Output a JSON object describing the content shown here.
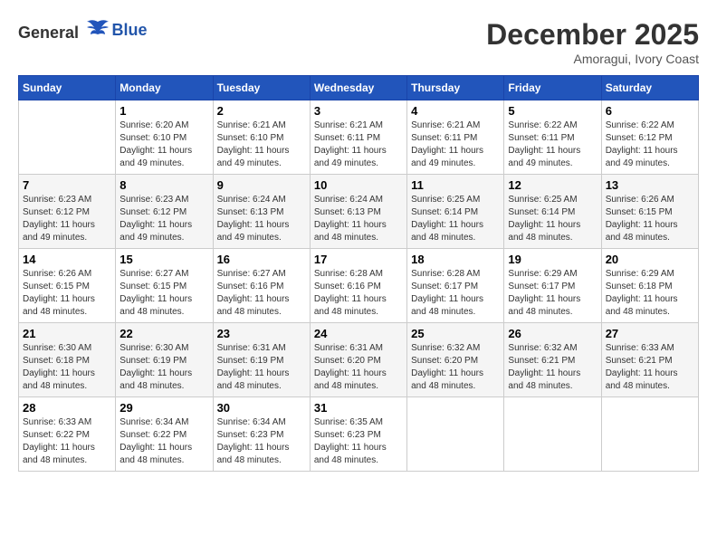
{
  "header": {
    "logo_general": "General",
    "logo_blue": "Blue",
    "month": "December 2025",
    "location": "Amoragui, Ivory Coast"
  },
  "weekdays": [
    "Sunday",
    "Monday",
    "Tuesday",
    "Wednesday",
    "Thursday",
    "Friday",
    "Saturday"
  ],
  "weeks": [
    [
      {
        "day": "",
        "sunrise": "",
        "sunset": "",
        "daylight": ""
      },
      {
        "day": "1",
        "sunrise": "Sunrise: 6:20 AM",
        "sunset": "Sunset: 6:10 PM",
        "daylight": "Daylight: 11 hours and 49 minutes."
      },
      {
        "day": "2",
        "sunrise": "Sunrise: 6:21 AM",
        "sunset": "Sunset: 6:10 PM",
        "daylight": "Daylight: 11 hours and 49 minutes."
      },
      {
        "day": "3",
        "sunrise": "Sunrise: 6:21 AM",
        "sunset": "Sunset: 6:11 PM",
        "daylight": "Daylight: 11 hours and 49 minutes."
      },
      {
        "day": "4",
        "sunrise": "Sunrise: 6:21 AM",
        "sunset": "Sunset: 6:11 PM",
        "daylight": "Daylight: 11 hours and 49 minutes."
      },
      {
        "day": "5",
        "sunrise": "Sunrise: 6:22 AM",
        "sunset": "Sunset: 6:11 PM",
        "daylight": "Daylight: 11 hours and 49 minutes."
      },
      {
        "day": "6",
        "sunrise": "Sunrise: 6:22 AM",
        "sunset": "Sunset: 6:12 PM",
        "daylight": "Daylight: 11 hours and 49 minutes."
      }
    ],
    [
      {
        "day": "7",
        "sunrise": "Sunrise: 6:23 AM",
        "sunset": "Sunset: 6:12 PM",
        "daylight": "Daylight: 11 hours and 49 minutes."
      },
      {
        "day": "8",
        "sunrise": "Sunrise: 6:23 AM",
        "sunset": "Sunset: 6:12 PM",
        "daylight": "Daylight: 11 hours and 49 minutes."
      },
      {
        "day": "9",
        "sunrise": "Sunrise: 6:24 AM",
        "sunset": "Sunset: 6:13 PM",
        "daylight": "Daylight: 11 hours and 49 minutes."
      },
      {
        "day": "10",
        "sunrise": "Sunrise: 6:24 AM",
        "sunset": "Sunset: 6:13 PM",
        "daylight": "Daylight: 11 hours and 48 minutes."
      },
      {
        "day": "11",
        "sunrise": "Sunrise: 6:25 AM",
        "sunset": "Sunset: 6:14 PM",
        "daylight": "Daylight: 11 hours and 48 minutes."
      },
      {
        "day": "12",
        "sunrise": "Sunrise: 6:25 AM",
        "sunset": "Sunset: 6:14 PM",
        "daylight": "Daylight: 11 hours and 48 minutes."
      },
      {
        "day": "13",
        "sunrise": "Sunrise: 6:26 AM",
        "sunset": "Sunset: 6:15 PM",
        "daylight": "Daylight: 11 hours and 48 minutes."
      }
    ],
    [
      {
        "day": "14",
        "sunrise": "Sunrise: 6:26 AM",
        "sunset": "Sunset: 6:15 PM",
        "daylight": "Daylight: 11 hours and 48 minutes."
      },
      {
        "day": "15",
        "sunrise": "Sunrise: 6:27 AM",
        "sunset": "Sunset: 6:15 PM",
        "daylight": "Daylight: 11 hours and 48 minutes."
      },
      {
        "day": "16",
        "sunrise": "Sunrise: 6:27 AM",
        "sunset": "Sunset: 6:16 PM",
        "daylight": "Daylight: 11 hours and 48 minutes."
      },
      {
        "day": "17",
        "sunrise": "Sunrise: 6:28 AM",
        "sunset": "Sunset: 6:16 PM",
        "daylight": "Daylight: 11 hours and 48 minutes."
      },
      {
        "day": "18",
        "sunrise": "Sunrise: 6:28 AM",
        "sunset": "Sunset: 6:17 PM",
        "daylight": "Daylight: 11 hours and 48 minutes."
      },
      {
        "day": "19",
        "sunrise": "Sunrise: 6:29 AM",
        "sunset": "Sunset: 6:17 PM",
        "daylight": "Daylight: 11 hours and 48 minutes."
      },
      {
        "day": "20",
        "sunrise": "Sunrise: 6:29 AM",
        "sunset": "Sunset: 6:18 PM",
        "daylight": "Daylight: 11 hours and 48 minutes."
      }
    ],
    [
      {
        "day": "21",
        "sunrise": "Sunrise: 6:30 AM",
        "sunset": "Sunset: 6:18 PM",
        "daylight": "Daylight: 11 hours and 48 minutes."
      },
      {
        "day": "22",
        "sunrise": "Sunrise: 6:30 AM",
        "sunset": "Sunset: 6:19 PM",
        "daylight": "Daylight: 11 hours and 48 minutes."
      },
      {
        "day": "23",
        "sunrise": "Sunrise: 6:31 AM",
        "sunset": "Sunset: 6:19 PM",
        "daylight": "Daylight: 11 hours and 48 minutes."
      },
      {
        "day": "24",
        "sunrise": "Sunrise: 6:31 AM",
        "sunset": "Sunset: 6:20 PM",
        "daylight": "Daylight: 11 hours and 48 minutes."
      },
      {
        "day": "25",
        "sunrise": "Sunrise: 6:32 AM",
        "sunset": "Sunset: 6:20 PM",
        "daylight": "Daylight: 11 hours and 48 minutes."
      },
      {
        "day": "26",
        "sunrise": "Sunrise: 6:32 AM",
        "sunset": "Sunset: 6:21 PM",
        "daylight": "Daylight: 11 hours and 48 minutes."
      },
      {
        "day": "27",
        "sunrise": "Sunrise: 6:33 AM",
        "sunset": "Sunset: 6:21 PM",
        "daylight": "Daylight: 11 hours and 48 minutes."
      }
    ],
    [
      {
        "day": "28",
        "sunrise": "Sunrise: 6:33 AM",
        "sunset": "Sunset: 6:22 PM",
        "daylight": "Daylight: 11 hours and 48 minutes."
      },
      {
        "day": "29",
        "sunrise": "Sunrise: 6:34 AM",
        "sunset": "Sunset: 6:22 PM",
        "daylight": "Daylight: 11 hours and 48 minutes."
      },
      {
        "day": "30",
        "sunrise": "Sunrise: 6:34 AM",
        "sunset": "Sunset: 6:23 PM",
        "daylight": "Daylight: 11 hours and 48 minutes."
      },
      {
        "day": "31",
        "sunrise": "Sunrise: 6:35 AM",
        "sunset": "Sunset: 6:23 PM",
        "daylight": "Daylight: 11 hours and 48 minutes."
      },
      {
        "day": "",
        "sunrise": "",
        "sunset": "",
        "daylight": ""
      },
      {
        "day": "",
        "sunrise": "",
        "sunset": "",
        "daylight": ""
      },
      {
        "day": "",
        "sunrise": "",
        "sunset": "",
        "daylight": ""
      }
    ]
  ]
}
